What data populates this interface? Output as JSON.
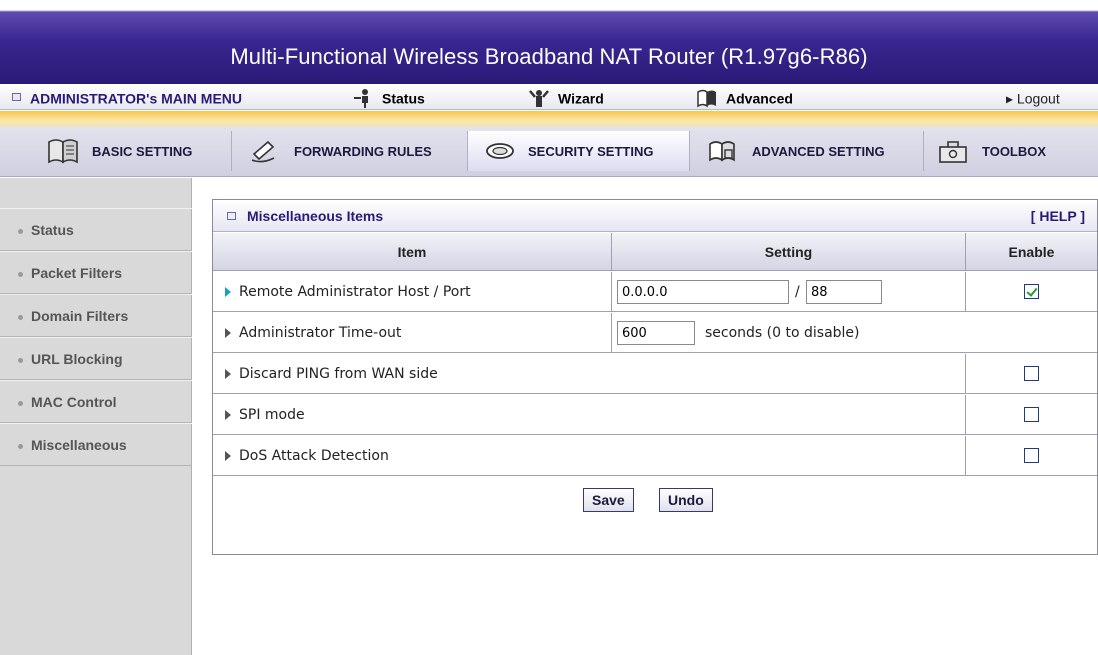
{
  "banner": {
    "title": "Multi-Functional Wireless Broadband NAT Router (R1.97g6-R86)"
  },
  "main_menu": {
    "admin_label": "ADMINISTRATOR's MAIN MENU",
    "status_label": "Status",
    "wizard_label": "Wizard",
    "advanced_label": "Advanced",
    "logout_label": "▸ Logout"
  },
  "tabs": [
    {
      "label": "BASIC SETTING",
      "icon": "book-icon",
      "active": false
    },
    {
      "label": "FORWARDING RULES",
      "icon": "pen-icon",
      "active": false
    },
    {
      "label": "SECURITY SETTING",
      "icon": "lock-eye-icon",
      "active": true
    },
    {
      "label": "ADVANCED SETTING",
      "icon": "advanced-icon",
      "active": false
    },
    {
      "label": "TOOLBOX",
      "icon": "toolbox-icon",
      "active": false
    }
  ],
  "sidebar": {
    "items": [
      {
        "label": "Status"
      },
      {
        "label": "Packet Filters"
      },
      {
        "label": "Domain Filters"
      },
      {
        "label": "URL Blocking"
      },
      {
        "label": "MAC Control"
      },
      {
        "label": "Miscellaneous"
      }
    ]
  },
  "panel": {
    "title": "Miscellaneous Items",
    "help": "[ HELP ]",
    "headers": {
      "item": "Item",
      "setting": "Setting",
      "enable": "Enable"
    },
    "rows": {
      "remote_admin": {
        "label": "Remote Administrator Host / Port",
        "host": "0.0.0.0",
        "slash": "/",
        "port": "88",
        "enabled": true
      },
      "timeout": {
        "label": "Administrator Time-out",
        "value": "600",
        "suffix": "seconds (0 to disable)"
      },
      "discard_ping": {
        "label": "Discard PING from WAN side",
        "enabled": false
      },
      "spi": {
        "label": "SPI mode",
        "enabled": false
      },
      "dos": {
        "label": "DoS Attack Detection",
        "enabled": false
      }
    },
    "buttons": {
      "save": "Save",
      "undo": "Undo"
    }
  }
}
